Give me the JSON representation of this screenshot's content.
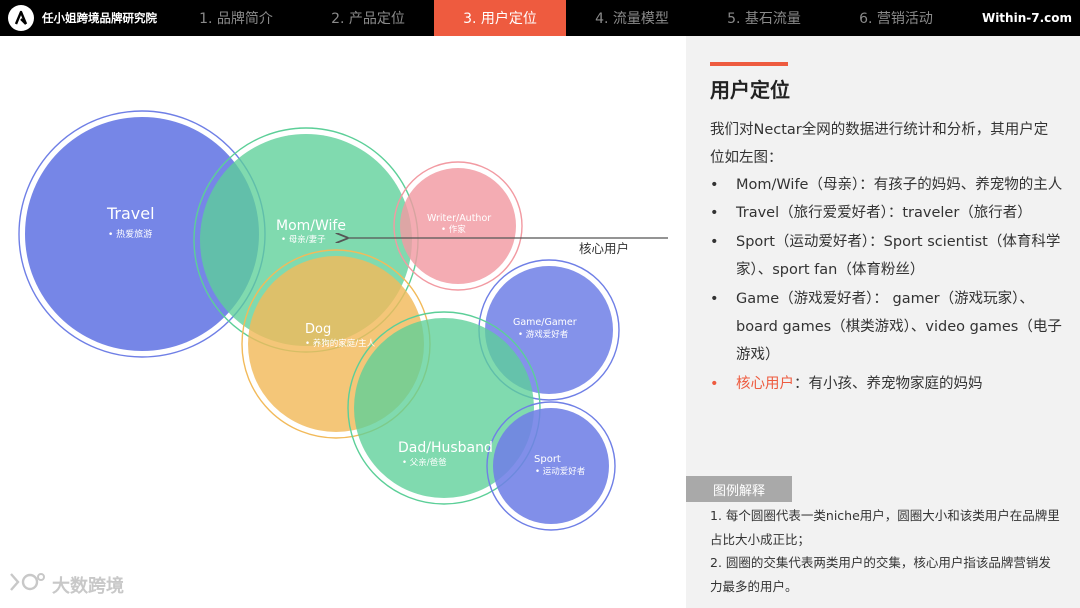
{
  "header": {
    "brand": "任小姐跨境品牌研究院",
    "site": "Within-7.com",
    "tabs": [
      {
        "label": "1. 品牌简介",
        "active": false
      },
      {
        "label": "2. 产品定位",
        "active": false
      },
      {
        "label": "3. 用户定位",
        "active": true
      },
      {
        "label": "4. 流量模型",
        "active": false
      },
      {
        "label": "5. 基石流量",
        "active": false
      },
      {
        "label": "6. 营销活动",
        "active": false
      }
    ]
  },
  "colors": {
    "accent": "#ee5b3f",
    "blue": "#6f7fe6",
    "green": "#5ccf98",
    "pink": "#f29aa2",
    "orange": "#f2ba5a"
  },
  "diagram": {
    "circles": [
      {
        "title": "Travel",
        "subtitle": "热爱旅游",
        "color": "blue"
      },
      {
        "title": "Mom/Wife",
        "subtitle": "母亲/妻子",
        "color": "green"
      },
      {
        "title": "Writer/Author",
        "subtitle": "作家",
        "color": "pink"
      },
      {
        "title": "Dog",
        "subtitle": "养狗的家庭/主人",
        "color": "orange"
      },
      {
        "title": "Game/Gamer",
        "subtitle": "游戏爱好者",
        "color": "blue"
      },
      {
        "title": "Dad/Husband",
        "subtitle": "父亲/爸爸",
        "color": "green"
      },
      {
        "title": "Sport",
        "subtitle": "运动爱好者",
        "color": "blue"
      }
    ],
    "core_label": "核心用户"
  },
  "watermark": "大数跨境",
  "panel": {
    "title": "用户定位",
    "intro": "我们对Nectar全网的数据进行统计和分析，其用户定位如左图：",
    "bullets": [
      {
        "label": "",
        "text": "Mom/Wife（母亲）：有孩子的妈妈、养宠物的主人",
        "core": false
      },
      {
        "label": "",
        "text": "Travel（旅行爱爱好者）：traveler（旅行者）",
        "core": false
      },
      {
        "label": "",
        "text": "Sport（运动爱好者）：Sport scientist（体育科学家）、sport fan（体育粉丝）",
        "core": false
      },
      {
        "label": "",
        "text": "Game（游戏爱好者）： gamer（游戏玩家）、board games（棋类游戏）、video games（电子游戏）",
        "core": false
      },
      {
        "label": "核心用户",
        "text": "：有小孩、养宠物家庭的妈妈",
        "core": true
      }
    ],
    "legend_title": "图例解释",
    "legend_lines": [
      "1. 每个圆圈代表一类niche用户，圆圈大小和该类用户在品牌里占比大小成正比；",
      "2. 圆圈的交集代表两类用户的交集，核心用户指该品牌营销发力最多的用户。"
    ]
  }
}
